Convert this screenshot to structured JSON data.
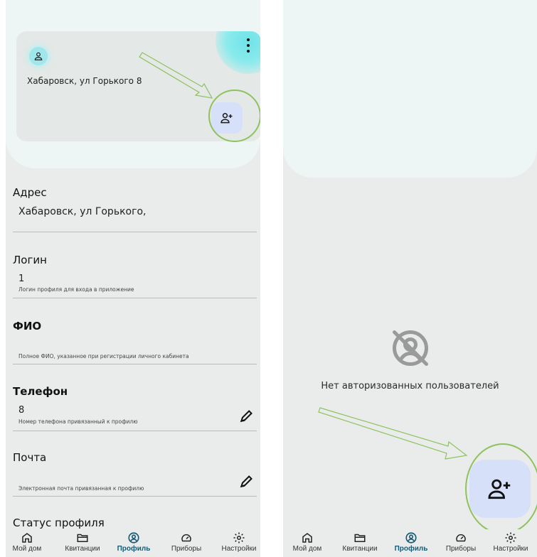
{
  "left": {
    "card": {
      "address": "Хабаровск, ул Горького 8"
    },
    "fields": {
      "address": {
        "title": "Адрес",
        "value": "Хабаровск, ул Горького,"
      },
      "login": {
        "title": "Логин",
        "value": "1",
        "hint": "Логин профиля для входа в приложение"
      },
      "fio": {
        "title": "ФИО",
        "value": "",
        "hint": "Полное ФИО, указанное при регистрации личного кабинета"
      },
      "phone": {
        "title": "Телефон",
        "value": "8",
        "hint": "Номер телефона привязанный к профилю"
      },
      "email": {
        "title": "Почта",
        "value": "",
        "hint": "Электронная почта привязанная к профилю"
      },
      "status": {
        "title": "Статус профиля"
      }
    }
  },
  "right": {
    "empty_text": "Нет авторизованных пользователей"
  },
  "tabbar": {
    "items": [
      {
        "label": "Мой дом",
        "icon": "home-icon"
      },
      {
        "label": "Квитанции",
        "icon": "folder-icon"
      },
      {
        "label": "Профиль",
        "icon": "profile-icon",
        "active": true
      },
      {
        "label": "Приборы",
        "icon": "gauge-icon"
      },
      {
        "label": "Настройки",
        "icon": "gear-icon"
      }
    ]
  },
  "colors": {
    "accent": "#165a74",
    "button_bg": "#d6e0f8",
    "highlight_ring": "#8ec25f",
    "glow": "#6fe3e8"
  }
}
